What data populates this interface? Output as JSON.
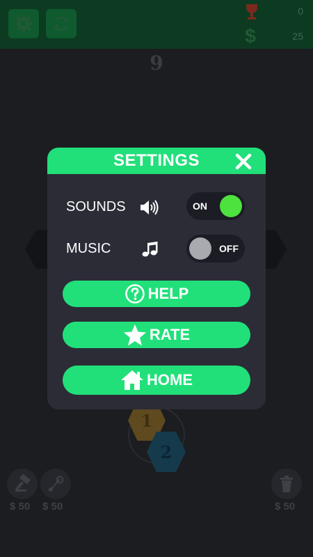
{
  "topbar": {
    "icons": {
      "settings": "gear-icon",
      "restart": "refresh-icon",
      "score": "trophy-icon",
      "coins": "dollar-icon"
    },
    "score_value": "0",
    "coins_value": "25",
    "dollar_symbol": "$"
  },
  "board": {
    "level": "9",
    "tiles": [
      "1",
      "2"
    ]
  },
  "tools": {
    "hammer_price": "$ 50",
    "swap_price": "$ 50",
    "trash_price": "$ 50",
    "icons": {
      "hammer": "hammer-icon",
      "swap": "swap-icon",
      "trash": "trash-icon"
    }
  },
  "settings": {
    "title": "SETTINGS",
    "sounds_label": "SOUNDS",
    "sounds_state": "ON",
    "music_label": "MUSIC",
    "music_state": "OFF",
    "help_label": "HELP",
    "rate_label": "RATE",
    "home_label": "HOME",
    "icons": {
      "close": "close-icon",
      "sounds": "speaker-icon",
      "music": "music-note-icon",
      "help": "question-icon",
      "rate": "star-icon",
      "home": "home-icon"
    },
    "colors": {
      "accent": "#21e07a",
      "dialog_bg": "#2b2c36",
      "toggle_on": "#4de23e",
      "toggle_off": "#a9a9b0"
    }
  }
}
